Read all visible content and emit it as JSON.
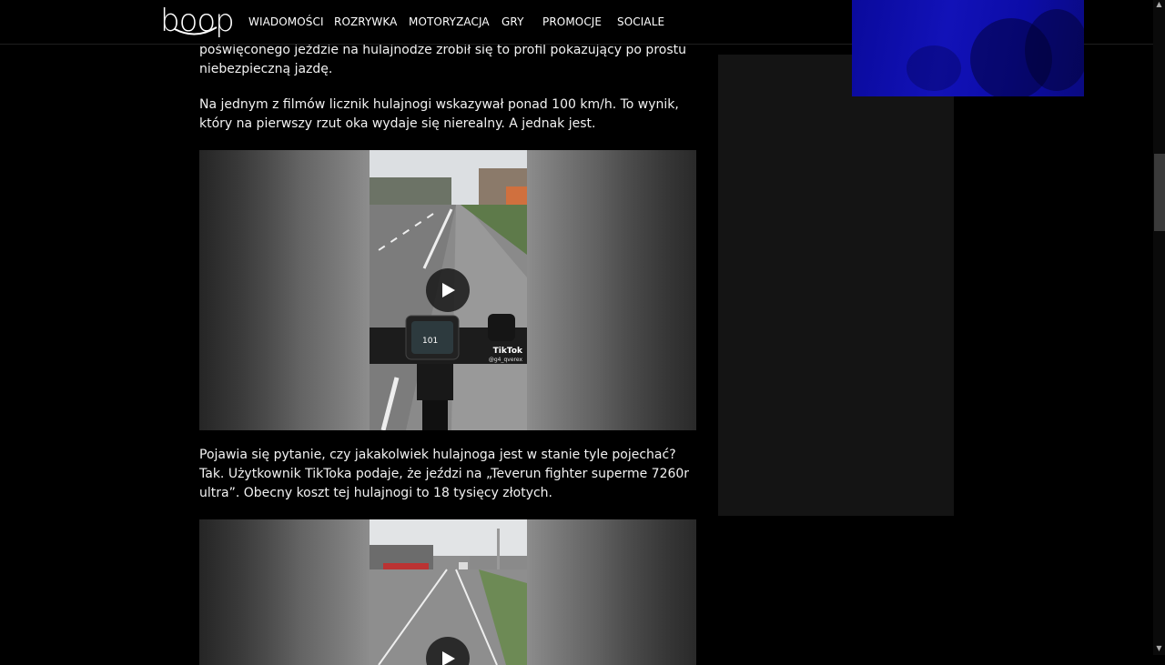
{
  "header": {
    "logo_text": "boop",
    "nav": [
      "WIADOMOŚCI",
      "ROZRYWKA",
      "MOTORYZACJA",
      "GRY",
      "PROMOCJE",
      "SOCIALE"
    ]
  },
  "article": {
    "para_1": "poświęconego jeździe na hulajnodze zrobił się to profil pokazujący po prostu niebezpieczną jazdę.",
    "para_2": "Na jednym z filmów licznik hulajnogi wskazywał ponad 100 km/h. To wynik, który na pierwszy rzut oka wydaje się nierealny. A jednak jest.",
    "para_3": "Pojawia się pytanie, czy jakakolwiek hulajnoga jest w stanie tyle pojechać? Tak. Użytkownik TikToka podaje, że jeździ na „Teverun fighter superme 7260r ultra”. Obecny koszt tej hulajnogi to 18 tysięcy złotych.",
    "video_1": {
      "speed_readout": "101",
      "watermark": "TikTok",
      "handle": "@g4_qverex"
    },
    "video_2": {}
  },
  "colors": {
    "background": "#000000",
    "ad_blue": "#1212b8",
    "sidebar": "#141414"
  }
}
